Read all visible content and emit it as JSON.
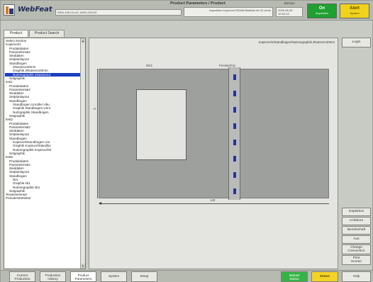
{
  "header": {
    "title": "Product Parameters / Product",
    "brand": "WebFeat",
    "version": "WNV-105.02-rc2, WNO-105.03",
    "inspection": "Inspektion Kopievorl R0168 Material ein 24 s/min",
    "service_label": "Service",
    "date": "2009-06-30",
    "time": "10:00:13",
    "status_on": {
      "label": "On",
      "sub": "Inspektion"
    },
    "status_alert": {
      "label": "Alert",
      "sub": "System"
    },
    "colors": {
      "on": "#1fa030",
      "alert": "#f0d21c",
      "brand": "#1f2a5c"
    }
  },
  "tabs": [
    {
      "label": "Product"
    },
    {
      "label": "Product Search"
    }
  ],
  "tree": {
    "items": [
      {
        "label": "Select Section",
        "indent": 0
      },
      {
        "label": "Kopievorl1",
        "indent": 0
      },
      {
        "label": "Produktdaten",
        "indent": 1
      },
      {
        "label": "Parametersatz",
        "indent": 1
      },
      {
        "label": "Sieddaten",
        "indent": 1
      },
      {
        "label": "Setplanlayout",
        "indent": 1
      },
      {
        "label": "Standbogen",
        "indent": 1
      },
      {
        "label": "2Nutzen140mm",
        "indent": 2
      },
      {
        "label": "Graphik 2Nutzen140mm",
        "indent": 2
      },
      {
        "label": "Nutzengraphik 2Nutzen14",
        "indent": 2,
        "selected": true
      },
      {
        "label": "Setgraphik",
        "indent": 1
      },
      {
        "label": "test1",
        "indent": 0
      },
      {
        "label": "Produktdaten",
        "indent": 1
      },
      {
        "label": "Parametersatz",
        "indent": 1
      },
      {
        "label": "Sieddaten",
        "indent": 1
      },
      {
        "label": "Setplanlayout",
        "indent": 1
      },
      {
        "label": "Standbogen",
        "indent": 1
      },
      {
        "label": "Standbogen Unroller Hbu",
        "indent": 2
      },
      {
        "label": "Graphik Standbogen Unro",
        "indent": 2
      },
      {
        "label": "Nutzgraphik Standbogen",
        "indent": 2
      },
      {
        "label": "Setgraphik",
        "indent": 1
      },
      {
        "label": "test2",
        "indent": 0
      },
      {
        "label": "Produktdaten",
        "indent": 1
      },
      {
        "label": "Parametersatz",
        "indent": 1
      },
      {
        "label": "Sieddaten",
        "indent": 1
      },
      {
        "label": "Setplanlayout",
        "indent": 1
      },
      {
        "label": "Standbogen",
        "indent": 1
      },
      {
        "label": "KopievorlStandbogen Unr",
        "indent": 2
      },
      {
        "label": "Graphik KopievorlStandbo",
        "indent": 2
      },
      {
        "label": "Nutzengraphik KopievorlSt",
        "indent": 2
      },
      {
        "label": "Setgraphik",
        "indent": 1
      },
      {
        "label": "test6",
        "indent": 0
      },
      {
        "label": "Produktdaten",
        "indent": 1
      },
      {
        "label": "Parametersatz",
        "indent": 1
      },
      {
        "label": "Sieddaten",
        "indent": 1
      },
      {
        "label": "Setplanlayout",
        "indent": 1
      },
      {
        "label": "Standbogen",
        "indent": 1
      },
      {
        "label": "sb1",
        "indent": 2
      },
      {
        "label": "Graphik sb1",
        "indent": 2
      },
      {
        "label": "Nutzengraphik sb1",
        "indent": 2
      },
      {
        "label": "Setgraphik",
        "indent": 1
      },
      {
        "label": "Teodeseventar",
        "indent": 0
      },
      {
        "label": "PeriodenDetektor",
        "indent": 0
      }
    ]
  },
  "content": {
    "path": "Kopievorl1/Standbogen/Nutzengraphik 2Nutzen140mm",
    "label_w": "W21",
    "label_fen": "Fenster(Fa)",
    "label_h": "H",
    "label_140": "140"
  },
  "right_buttons": [
    {
      "label": "Login"
    },
    {
      "label": "Inspektion"
    },
    {
      "label": "Anfahren"
    },
    {
      "label": "Bereitschaft"
    },
    {
      "label": "Aus"
    },
    {
      "label": "Change",
      "label2": "Connection"
    },
    {
      "label": "Print",
      "label2": "Screen"
    }
  ],
  "bottom_buttons": [
    {
      "label": "Current",
      "label2": "Production"
    },
    {
      "label": "Production",
      "label2": "History"
    },
    {
      "label": "Product",
      "label2": "Parameters"
    },
    {
      "label": "System"
    },
    {
      "label": "Setup"
    },
    {
      "label": "Maintel",
      "label2": "Status"
    },
    {
      "label": "Status"
    },
    {
      "label": "Help"
    }
  ]
}
